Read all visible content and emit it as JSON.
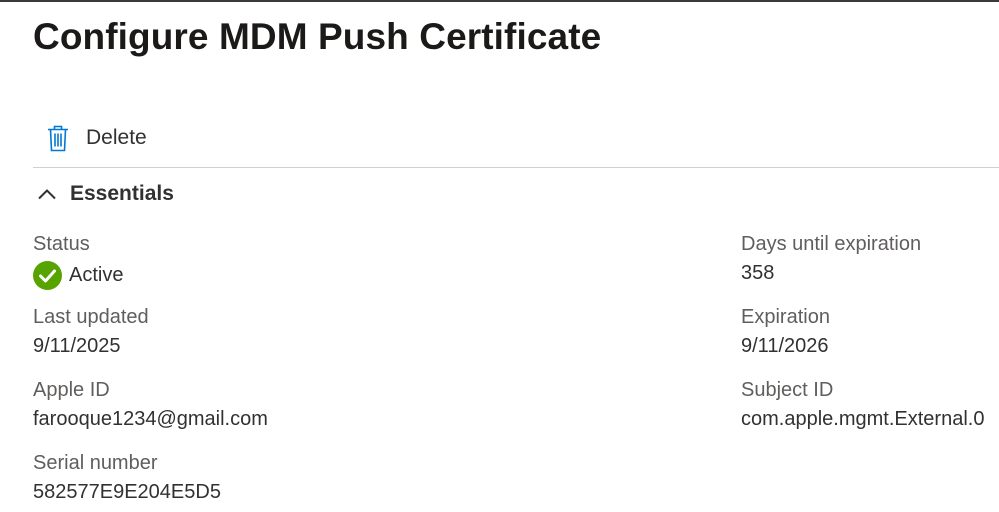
{
  "page": {
    "title": "Configure MDM Push Certificate"
  },
  "toolbar": {
    "delete_label": "Delete",
    "delete_icon": "trash-icon"
  },
  "essentials": {
    "label": "Essentials",
    "toggle_icon": "chevron-up-icon",
    "left": [
      {
        "label": "Status",
        "value": "Active",
        "icon": "check-circle-icon",
        "icon_color": "#57a300"
      },
      {
        "label": "Last updated",
        "value": "9/11/2025"
      },
      {
        "label": "Apple ID",
        "value": "farooque1234@gmail.com"
      },
      {
        "label": "Serial number",
        "value": "582577E9E204E5D5"
      }
    ],
    "right": [
      {
        "label": "Days until expiration",
        "value": "358"
      },
      {
        "label": "Expiration",
        "value": "9/11/2026"
      },
      {
        "label": "Subject ID",
        "value": "com.apple.mgmt.External.0"
      }
    ]
  },
  "colors": {
    "accent": "#0078d4",
    "success": "#57a300",
    "text": "#323130",
    "label_text": "#605e5c"
  }
}
